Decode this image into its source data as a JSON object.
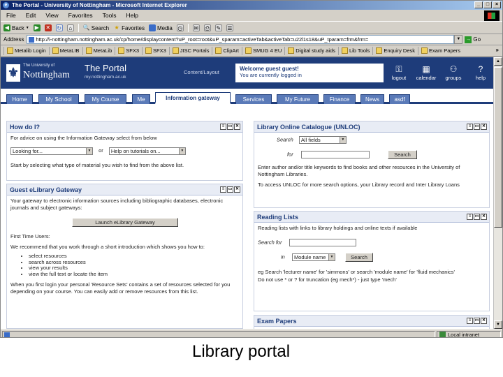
{
  "window": {
    "title": "The Portal - University of Nottingham - Microsoft Internet Explorer",
    "menu": [
      "File",
      "Edit",
      "View",
      "Favorites",
      "Tools",
      "Help"
    ],
    "toolbar": {
      "back": "Back",
      "search": "Search",
      "favorites": "Favorites",
      "media": "Media"
    },
    "address": {
      "label": "Address",
      "url": "http://i-nottingham.nottingham.ac.uk/cp/home/displaycontent?uP_root=root&uP_sparam=activeTab&activeTab=u22l1s18&uP_tparam=frm&frm=",
      "go": "Go"
    },
    "links": [
      "Metalib Login",
      "MetaLIB",
      "MetaLib",
      "SFX3",
      "SFX3",
      "JISC Portals",
      "ClipArt",
      "SMUG 4 EU",
      "Digital study aids",
      "Lib Tools",
      "Enquiry Desk",
      "Exam Papers"
    ],
    "status": {
      "left": "",
      "zone": "Local intranet"
    }
  },
  "portal": {
    "logo_university": "The University of",
    "logo_name": "Nottingham",
    "title": "The Portal",
    "url": "my.nottingham.ac.uk",
    "content_layout": "Content/Layout",
    "welcome": "Welcome guest guest!",
    "logged_in": "You are currently logged in",
    "tools": [
      {
        "label": "logout",
        "icon": "key-icon"
      },
      {
        "label": "calendar",
        "icon": "calendar-icon"
      },
      {
        "label": "groups",
        "icon": "groups-icon"
      },
      {
        "label": "help",
        "icon": "help-icon"
      }
    ],
    "tabs": [
      "Home",
      "My School",
      "My Course",
      "Me",
      "Information gateway",
      "Services",
      "My Future",
      "Finance",
      "News",
      "asdf"
    ],
    "active_tab": "Information gateway"
  },
  "channels": {
    "how_do_i": {
      "title": "How do I?",
      "intro": "For advice on using the Information Gateway select from below",
      "select1": "Looking for...",
      "or": "or",
      "select2": "Help on tutorials on...",
      "hint": "Start by selecting what type of material you wish to find from the above list."
    },
    "elibrary": {
      "title": "Guest eLibrary Gateway",
      "intro": "Your gateway to electronic information sources including bibliographic databases, electronic journals and subject gateways:",
      "button": "Launch eLibrary Gateway",
      "first_time_heading": "First Time Users:",
      "first_time_text": "We recommend that you work through a short introduction which shows you how to:",
      "bullets": [
        "select resources",
        "search across resources",
        "view your results",
        "view the full text or locate the item"
      ],
      "footer": "When you first login your personal 'Resource Sets' contains a set of resources selected for you depending on your course. You can easily add or remove resources from this list."
    },
    "library_catalogue": {
      "title": "Library Online Catalogue (UNLOC)",
      "search_label": "Search",
      "search_select": "All fields",
      "for_label": "for",
      "button": "Search",
      "hint": "Enter author and/or title keywords to find books and other resources in the University of Nottingham Libraries.",
      "more": "To access UNLOC for more search options, your Library record and Inter Library Loans"
    },
    "reading_lists": {
      "title": "Reading Lists",
      "intro": "Reading lists with links to library holdings and online texts if available",
      "search_for_label": "Search for",
      "in_label": "in",
      "in_select": "Module name",
      "button": "Search",
      "eg": "eg Search 'lecturer name' for 'simmons' or search 'module name' for 'fluid mechanics'",
      "tip": "Do not use * or ? for truncation (eg mech*) - just type 'mech'"
    },
    "exam_papers": {
      "title": "Exam Papers"
    }
  },
  "caption": "Library portal"
}
